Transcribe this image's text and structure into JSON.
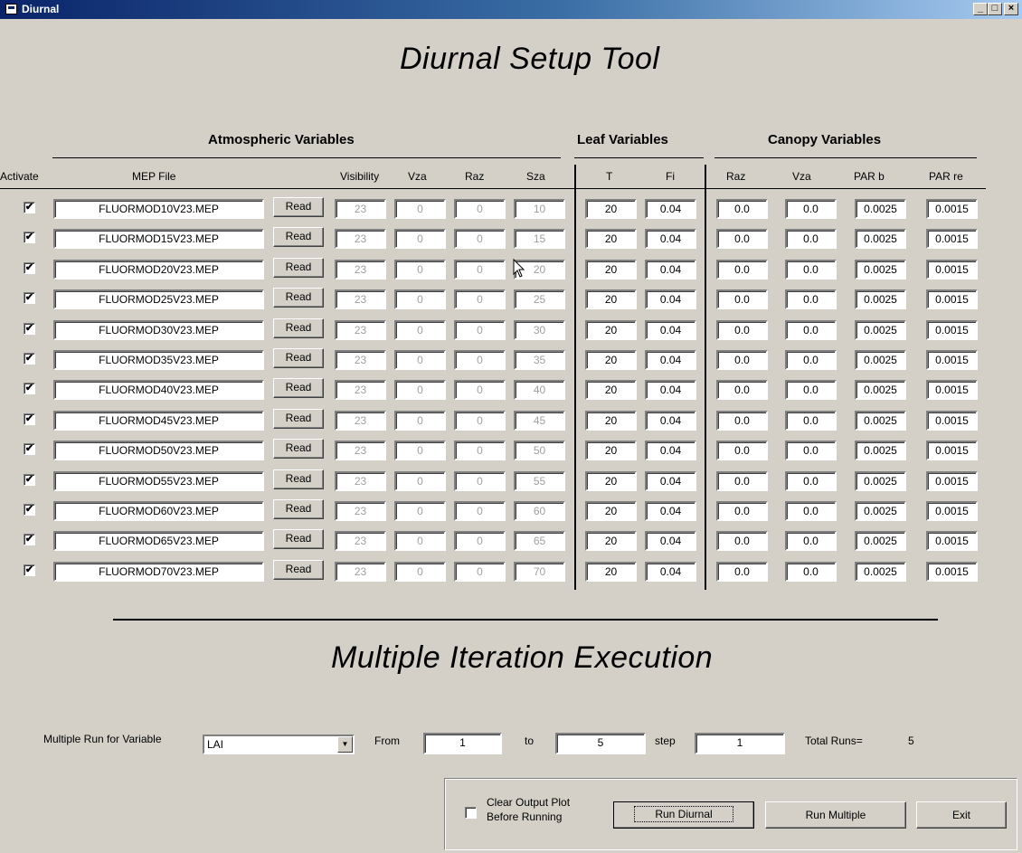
{
  "window": {
    "title": "Diurnal",
    "min": "_",
    "max": "□",
    "close": "×"
  },
  "heading": "Diurnal Setup Tool",
  "groups": {
    "atmospheric": "Atmospheric Variables",
    "leaf": "Leaf Variables",
    "canopy": "Canopy Variables"
  },
  "columns": {
    "activate": "Activate",
    "mep_file": "MEP File",
    "visibility": "Visibility",
    "vza": "Vza",
    "raz": "Raz",
    "sza": "Sza",
    "t": "T",
    "fi": "Fi",
    "c_raz": "Raz",
    "c_vza": "Vza",
    "par_b": "PAR b",
    "par_re": "PAR re"
  },
  "read_label": "Read",
  "checkmark": "✔",
  "rows": [
    {
      "file": "FLUORMOD10V23.MEP",
      "vis": "23",
      "vza": "0",
      "raz": "0",
      "sza": "10",
      "t": "20",
      "fi": "0.04",
      "c_raz": "0.0",
      "c_vza": "0.0",
      "par_b": "0.0025",
      "par_re": "0.0015"
    },
    {
      "file": "FLUORMOD15V23.MEP",
      "vis": "23",
      "vza": "0",
      "raz": "0",
      "sza": "15",
      "t": "20",
      "fi": "0.04",
      "c_raz": "0.0",
      "c_vza": "0.0",
      "par_b": "0.0025",
      "par_re": "0.0015"
    },
    {
      "file": "FLUORMOD20V23.MEP",
      "vis": "23",
      "vza": "0",
      "raz": "0",
      "sza": "20",
      "t": "20",
      "fi": "0.04",
      "c_raz": "0.0",
      "c_vza": "0.0",
      "par_b": "0.0025",
      "par_re": "0.0015"
    },
    {
      "file": "FLUORMOD25V23.MEP",
      "vis": "23",
      "vza": "0",
      "raz": "0",
      "sza": "25",
      "t": "20",
      "fi": "0.04",
      "c_raz": "0.0",
      "c_vza": "0.0",
      "par_b": "0.0025",
      "par_re": "0.0015"
    },
    {
      "file": "FLUORMOD30V23.MEP",
      "vis": "23",
      "vza": "0",
      "raz": "0",
      "sza": "30",
      "t": "20",
      "fi": "0.04",
      "c_raz": "0.0",
      "c_vza": "0.0",
      "par_b": "0.0025",
      "par_re": "0.0015"
    },
    {
      "file": "FLUORMOD35V23.MEP",
      "vis": "23",
      "vza": "0",
      "raz": "0",
      "sza": "35",
      "t": "20",
      "fi": "0.04",
      "c_raz": "0.0",
      "c_vza": "0.0",
      "par_b": "0.0025",
      "par_re": "0.0015"
    },
    {
      "file": "FLUORMOD40V23.MEP",
      "vis": "23",
      "vza": "0",
      "raz": "0",
      "sza": "40",
      "t": "20",
      "fi": "0.04",
      "c_raz": "0.0",
      "c_vza": "0.0",
      "par_b": "0.0025",
      "par_re": "0.0015"
    },
    {
      "file": "FLUORMOD45V23.MEP",
      "vis": "23",
      "vza": "0",
      "raz": "0",
      "sza": "45",
      "t": "20",
      "fi": "0.04",
      "c_raz": "0.0",
      "c_vza": "0.0",
      "par_b": "0.0025",
      "par_re": "0.0015"
    },
    {
      "file": "FLUORMOD50V23.MEP",
      "vis": "23",
      "vza": "0",
      "raz": "0",
      "sza": "50",
      "t": "20",
      "fi": "0.04",
      "c_raz": "0.0",
      "c_vza": "0.0",
      "par_b": "0.0025",
      "par_re": "0.0015"
    },
    {
      "file": "FLUORMOD55V23.MEP",
      "vis": "23",
      "vza": "0",
      "raz": "0",
      "sza": "55",
      "t": "20",
      "fi": "0.04",
      "c_raz": "0.0",
      "c_vza": "0.0",
      "par_b": "0.0025",
      "par_re": "0.0015"
    },
    {
      "file": "FLUORMOD60V23.MEP",
      "vis": "23",
      "vza": "0",
      "raz": "0",
      "sza": "60",
      "t": "20",
      "fi": "0.04",
      "c_raz": "0.0",
      "c_vza": "0.0",
      "par_b": "0.0025",
      "par_re": "0.0015"
    },
    {
      "file": "FLUORMOD65V23.MEP",
      "vis": "23",
      "vza": "0",
      "raz": "0",
      "sza": "65",
      "t": "20",
      "fi": "0.04",
      "c_raz": "0.0",
      "c_vza": "0.0",
      "par_b": "0.0025",
      "par_re": "0.0015"
    },
    {
      "file": "FLUORMOD70V23.MEP",
      "vis": "23",
      "vza": "0",
      "raz": "0",
      "sza": "70",
      "t": "20",
      "fi": "0.04",
      "c_raz": "0.0",
      "c_vza": "0.0",
      "par_b": "0.0025",
      "par_re": "0.0015"
    }
  ],
  "multi": {
    "heading": "Multiple Iteration Execution",
    "variable_label": "Multiple Run for Variable",
    "variable_value": "LAI",
    "from_label": "From",
    "from_value": "1",
    "to_label": "to",
    "to_value": "5",
    "step_label": "step",
    "step_value": "1",
    "total_label": "Total Runs=",
    "total_value": "5"
  },
  "footer": {
    "clear_line1": "Clear Output Plot",
    "clear_line2": "Before Running",
    "run_diurnal": "Run Diurnal",
    "run_multiple": "Run Multiple",
    "exit": "Exit"
  }
}
